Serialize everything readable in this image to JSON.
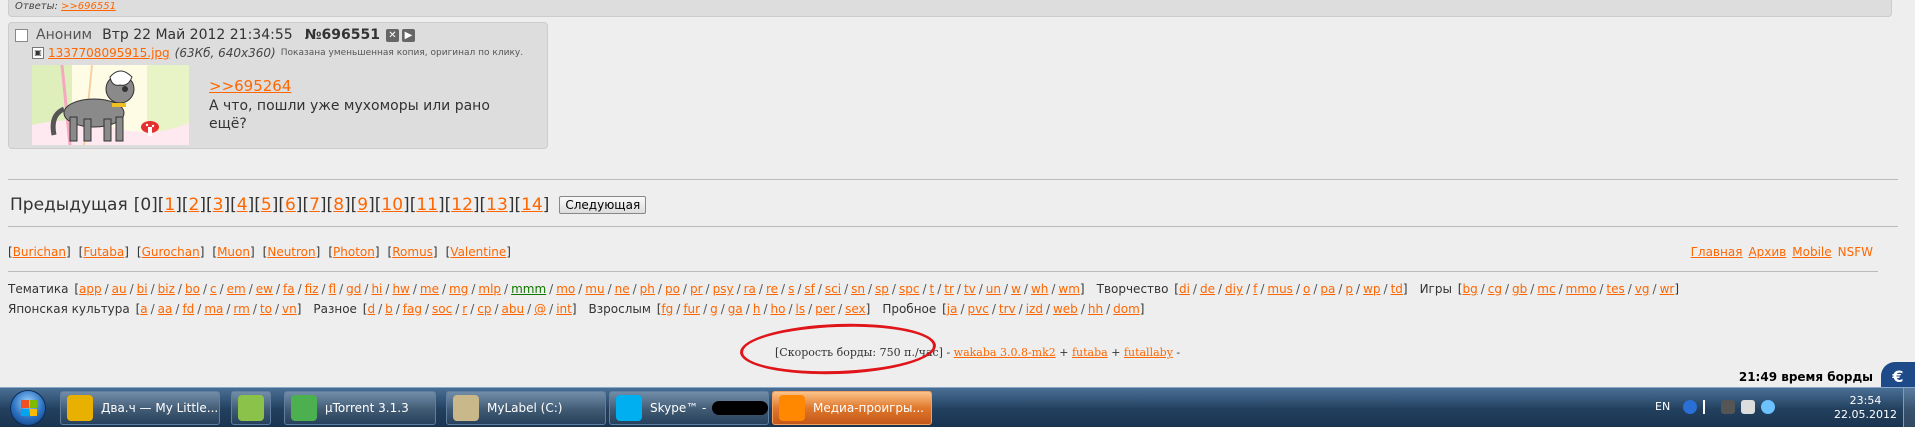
{
  "top": {
    "answers_label": "Ответы:",
    "answers_link": ">>696551"
  },
  "post": {
    "name": "Аноним",
    "date": "Втр 22 Май 2012 21:34:55",
    "number": "№696551",
    "file_link": "1337708095915.jpg",
    "file_meta": "(63Кб, 640x360)",
    "file_note": "Показана уменьшенная копия, оригинал по клику.",
    "reply_link": ">>695264",
    "text": "А что, пошли уже мухоморы или рано ещё?"
  },
  "pager": {
    "prev_label": "Предыдущая",
    "current": "[0]",
    "pages": [
      "1",
      "2",
      "3",
      "4",
      "5",
      "6",
      "7",
      "8",
      "9",
      "10",
      "11",
      "12",
      "13",
      "14"
    ],
    "next_label": "Следующая"
  },
  "engines": [
    "Burichan",
    "Futaba",
    "Gurochan",
    "Muon",
    "Neutron",
    "Photon",
    "Romus",
    "Valentine"
  ],
  "rightnav": [
    "Главная",
    "Архив",
    "Mobile",
    "NSFW"
  ],
  "boards": {
    "row1": [
      {
        "cat": "Тематика",
        "items": [
          "app",
          "au",
          "bi",
          "biz",
          "bo",
          "c",
          "em",
          "ew",
          "fa",
          "fiz",
          "fl",
          "gd",
          "hi",
          "hw",
          "me",
          "mg",
          "mlp",
          "mmm",
          "mo",
          "mu",
          "ne",
          "ph",
          "po",
          "pr",
          "psy",
          "ra",
          "re",
          "s",
          "sf",
          "sci",
          "sn",
          "sp",
          "spc",
          "t",
          "tr",
          "tv",
          "un",
          "w",
          "wh",
          "wm"
        ]
      },
      {
        "cat": "Творчество",
        "items": [
          "di",
          "de",
          "diy",
          "f",
          "mus",
          "o",
          "pa",
          "p",
          "wp",
          "td"
        ]
      },
      {
        "cat": "Игры",
        "items": [
          "bg",
          "cg",
          "gb",
          "mc",
          "mmo",
          "tes",
          "vg",
          "wr"
        ]
      }
    ],
    "row2": [
      {
        "cat": "Японская культура",
        "items": [
          "a",
          "aa",
          "fd",
          "ma",
          "rm",
          "to",
          "vn"
        ]
      },
      {
        "cat": "Разное",
        "items": [
          "d",
          "b",
          "fag",
          "soc",
          "r",
          "cp",
          "abu",
          "@",
          "int"
        ]
      },
      {
        "cat": "Взрослым",
        "items": [
          "fg",
          "fur",
          "g",
          "ga",
          "h",
          "ho",
          "ls",
          "per",
          "sex"
        ]
      },
      {
        "cat": "Пробное",
        "items": [
          "ja",
          "pvc",
          "trv",
          "izd",
          "web",
          "hh",
          "dom"
        ]
      }
    ]
  },
  "footer": {
    "speed": "[Скорость борды: 750 п./час]",
    "dash1": "-",
    "wakaba": "wakaba 3.0.8-mk2",
    "plus1": "+",
    "futaba": "futaba",
    "plus2": "+",
    "futallaby": "futallaby",
    "dash2": "-",
    "board_time": "21:49 время борды"
  },
  "taskbar": {
    "tasks": [
      {
        "label": "Два.ч — My Little...",
        "icon": "chrome-icon",
        "color": "#e8b000"
      },
      {
        "label": "",
        "icon": "notepad-icon",
        "color": "#8bc34a"
      },
      {
        "label": "µTorrent 3.1.3",
        "icon": "utorrent-icon",
        "color": "#4caf50"
      },
      {
        "label": "MyLabel (C:)",
        "icon": "folder-icon",
        "color": "#c9b88a"
      },
      {
        "label": "Skype™ -",
        "icon": "skype-icon",
        "color": "#00aff0"
      },
      {
        "label": "Медиа-проигры...",
        "icon": "vlc-icon",
        "color": "#ff8800"
      }
    ],
    "lang": "EN",
    "time": "23:54",
    "date": "22.05.2012"
  },
  "colors": {
    "link": "#ff6600",
    "highlight_circle": "#e0151a",
    "background": "#eeeeee"
  }
}
